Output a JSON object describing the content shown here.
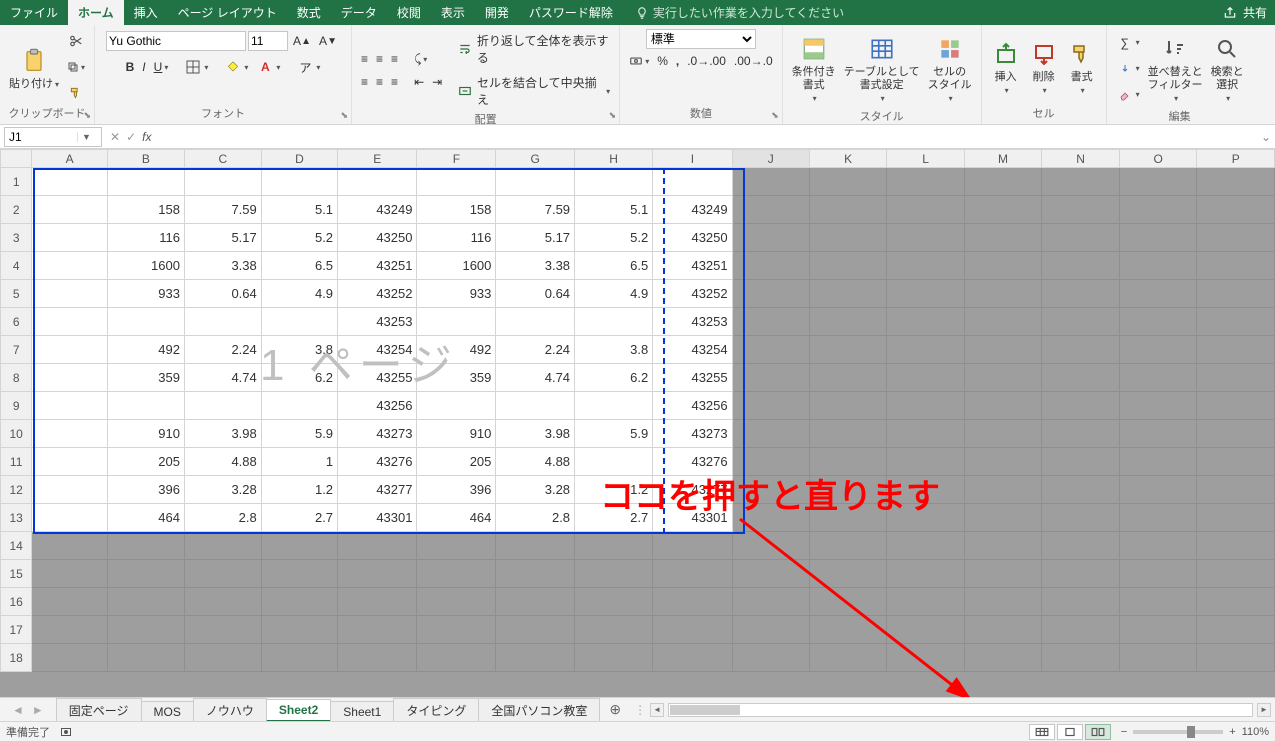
{
  "tabs": {
    "file": "ファイル",
    "home": "ホーム",
    "insert": "挿入",
    "page_layout": "ページ レイアウト",
    "formulas": "数式",
    "data": "データ",
    "review": "校閲",
    "view": "表示",
    "developer": "開発",
    "pw_unlock": "パスワード解除"
  },
  "tell_me_placeholder": "実行したい作業を入力してください",
  "share": "共有",
  "groups": {
    "clipboard": {
      "title": "クリップボード",
      "paste": "貼り付け"
    },
    "font": {
      "title": "フォント",
      "name": "Yu Gothic",
      "size": "11"
    },
    "alignment": {
      "title": "配置",
      "wrap": "折り返して全体を表示する",
      "merge": "セルを結合して中央揃え"
    },
    "number": {
      "title": "数値",
      "format": "標準"
    },
    "styles": {
      "title": "スタイル",
      "cond": "条件付き\n書式",
      "table": "テーブルとして\n書式設定",
      "cell": "セルの\nスタイル"
    },
    "cells": {
      "title": "セル",
      "insert": "挿入",
      "delete": "削除",
      "format": "書式"
    },
    "editing": {
      "title": "編集",
      "sort": "並べ替えと\nフィルター",
      "find": "検索と\n選択"
    }
  },
  "namebox": "J1",
  "columns": [
    "A",
    "B",
    "C",
    "D",
    "E",
    "F",
    "G",
    "H",
    "I",
    "J",
    "K",
    "L",
    "M",
    "N",
    "O",
    "P"
  ],
  "rows": [
    {
      "n": 1,
      "cells": [
        "",
        "",
        "",
        "",
        "",
        "",
        "",
        "",
        ""
      ]
    },
    {
      "n": 2,
      "cells": [
        "",
        "158",
        "7.59",
        "5.1",
        "43249",
        "158",
        "7.59",
        "5.1",
        "43249"
      ]
    },
    {
      "n": 3,
      "cells": [
        "",
        "116",
        "5.17",
        "5.2",
        "43250",
        "116",
        "5.17",
        "5.2",
        "43250"
      ]
    },
    {
      "n": 4,
      "cells": [
        "",
        "1600",
        "3.38",
        "6.5",
        "43251",
        "1600",
        "3.38",
        "6.5",
        "43251"
      ]
    },
    {
      "n": 5,
      "cells": [
        "",
        "933",
        "0.64",
        "4.9",
        "43252",
        "933",
        "0.64",
        "4.9",
        "43252"
      ]
    },
    {
      "n": 6,
      "cells": [
        "",
        "",
        "",
        "",
        "43253",
        "",
        "",
        "",
        "43253"
      ]
    },
    {
      "n": 7,
      "cells": [
        "",
        "492",
        "2.24",
        "3.8",
        "43254",
        "492",
        "2.24",
        "3.8",
        "43254"
      ]
    },
    {
      "n": 8,
      "cells": [
        "",
        "359",
        "4.74",
        "6.2",
        "43255",
        "359",
        "4.74",
        "6.2",
        "43255"
      ]
    },
    {
      "n": 9,
      "cells": [
        "",
        "",
        "",
        "",
        "43256",
        "",
        "",
        "",
        "43256"
      ]
    },
    {
      "n": 10,
      "cells": [
        "",
        "910",
        "3.98",
        "5.9",
        "43273",
        "910",
        "3.98",
        "5.9",
        "43273"
      ]
    },
    {
      "n": 11,
      "cells": [
        "",
        "205",
        "4.88",
        "1",
        "43276",
        "205",
        "4.88",
        "",
        "43276"
      ]
    },
    {
      "n": 12,
      "cells": [
        "",
        "396",
        "3.28",
        "1.2",
        "43277",
        "396",
        "3.28",
        "1.2",
        "43277"
      ]
    },
    {
      "n": 13,
      "cells": [
        "",
        "464",
        "2.8",
        "2.7",
        "43301",
        "464",
        "2.8",
        "2.7",
        "43301"
      ]
    }
  ],
  "extra_rows": [
    14,
    15,
    16,
    17,
    18
  ],
  "watermark": "1 ページ",
  "sheets": [
    "固定ページ",
    "MOS",
    "ノウハウ",
    "Sheet2",
    "Sheet1",
    "タイピング",
    "全国パソコン教室"
  ],
  "active_sheet": "Sheet2",
  "status_ready": "準備完了",
  "zoom": "110%",
  "annotation": "ココを押すと直ります"
}
